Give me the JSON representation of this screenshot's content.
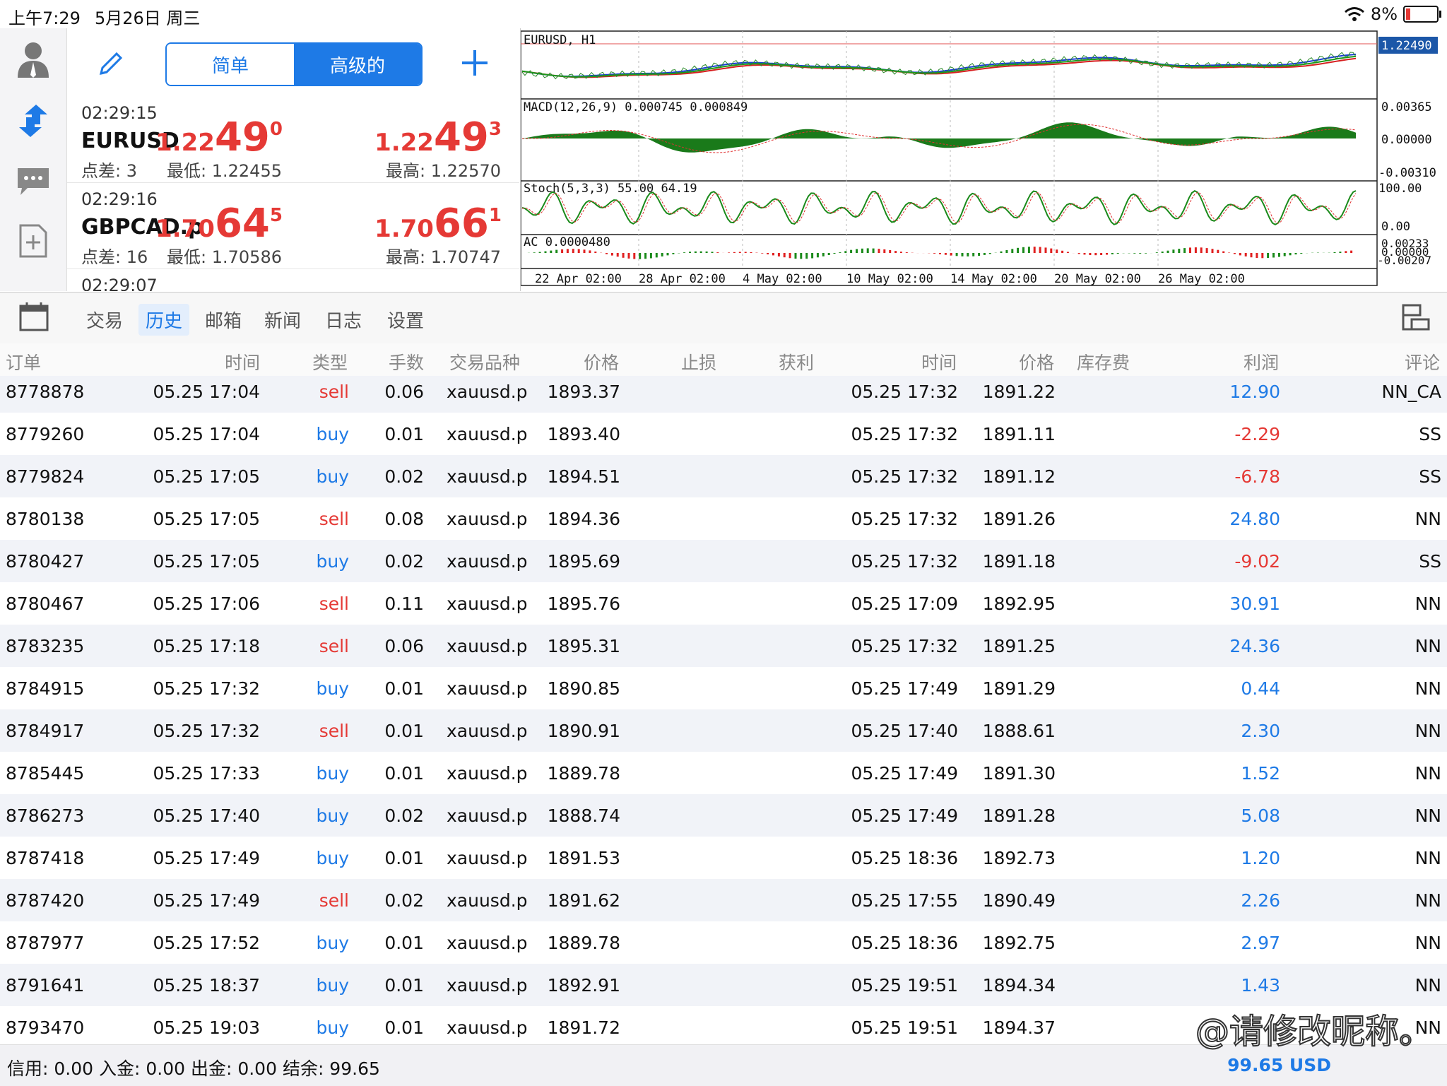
{
  "status_bar": {
    "time": "上午7:29",
    "date": "5月26日 周三",
    "battery": "8%"
  },
  "quotes": {
    "segment": {
      "simple": "简单",
      "advanced": "高级的"
    },
    "items": [
      {
        "time": "02:29:15",
        "symbol": "EURUSD",
        "spread": "点差: 3",
        "bid": {
          "a": "1.22",
          "b": "49",
          "c": "0"
        },
        "ask": {
          "a": "1.22",
          "b": "49",
          "c": "3"
        },
        "low": "最低: 1.22455",
        "high": "最高: 1.22570"
      },
      {
        "time": "02:29:16",
        "symbol": "GBPCAD.p",
        "spread": "点差: 16",
        "bid": {
          "a": "1.70",
          "b": "64",
          "c": "5"
        },
        "ask": {
          "a": "1.70",
          "b": "66",
          "c": "1"
        },
        "low": "最低: 1.70586",
        "high": "最高: 1.70747"
      },
      {
        "time": "02:29:07"
      }
    ]
  },
  "chart": {
    "main_title": "EURUSD, H1",
    "price_label": "1.22490",
    "macd_title": "MACD(12,26,9) 0.000745 0.000849",
    "macd_axis": [
      "0.00365",
      "0.00000",
      "-0.00310"
    ],
    "stoch_title": "Stoch(5,3,3) 55.00 64.19",
    "stoch_axis": [
      "100.00",
      "0.00"
    ],
    "ac_title": "AC 0.0000480",
    "ac_axis": [
      "0.00233",
      "0.00000",
      "-0.00207"
    ],
    "dates": [
      "22 Apr 02:00",
      "28 Apr 02:00",
      "4 May 02:00",
      "10 May 02:00",
      "14 May 02:00",
      "20 May 02:00",
      "26 May 02:00"
    ]
  },
  "tabs": [
    "交易",
    "历史",
    "邮箱",
    "新闻",
    "日志",
    "设置"
  ],
  "active_tab": "历史",
  "table": {
    "headers": [
      "订单",
      "时间",
      "类型",
      "手数",
      "交易品种",
      "价格",
      "止损",
      "获利",
      "时间",
      "价格",
      "库存费",
      "利润",
      "评论"
    ],
    "rows": [
      [
        "8778878",
        "05.25 17:04",
        "sell",
        "0.06",
        "xauusd.p",
        "1893.37",
        "05.25 17:32",
        "1891.22",
        "12.90",
        "NN_CA"
      ],
      [
        "8779260",
        "05.25 17:04",
        "buy",
        "0.01",
        "xauusd.p",
        "1893.40",
        "05.25 17:32",
        "1891.11",
        "-2.29",
        "SS"
      ],
      [
        "8779824",
        "05.25 17:05",
        "buy",
        "0.02",
        "xauusd.p",
        "1894.51",
        "05.25 17:32",
        "1891.12",
        "-6.78",
        "SS"
      ],
      [
        "8780138",
        "05.25 17:05",
        "sell",
        "0.08",
        "xauusd.p",
        "1894.36",
        "05.25 17:32",
        "1891.26",
        "24.80",
        "NN"
      ],
      [
        "8780427",
        "05.25 17:05",
        "buy",
        "0.02",
        "xauusd.p",
        "1895.69",
        "05.25 17:32",
        "1891.18",
        "-9.02",
        "SS"
      ],
      [
        "8780467",
        "05.25 17:06",
        "sell",
        "0.11",
        "xauusd.p",
        "1895.76",
        "05.25 17:09",
        "1892.95",
        "30.91",
        "NN"
      ],
      [
        "8783235",
        "05.25 17:18",
        "sell",
        "0.06",
        "xauusd.p",
        "1895.31",
        "05.25 17:32",
        "1891.25",
        "24.36",
        "NN"
      ],
      [
        "8784915",
        "05.25 17:32",
        "buy",
        "0.01",
        "xauusd.p",
        "1890.85",
        "05.25 17:49",
        "1891.29",
        "0.44",
        "NN"
      ],
      [
        "8784917",
        "05.25 17:32",
        "sell",
        "0.01",
        "xauusd.p",
        "1890.91",
        "05.25 17:40",
        "1888.61",
        "2.30",
        "NN"
      ],
      [
        "8785445",
        "05.25 17:33",
        "buy",
        "0.01",
        "xauusd.p",
        "1889.78",
        "05.25 17:49",
        "1891.30",
        "1.52",
        "NN"
      ],
      [
        "8786273",
        "05.25 17:40",
        "buy",
        "0.02",
        "xauusd.p",
        "1888.74",
        "05.25 17:49",
        "1891.28",
        "5.08",
        "NN"
      ],
      [
        "8787418",
        "05.25 17:49",
        "buy",
        "0.01",
        "xauusd.p",
        "1891.53",
        "05.25 18:36",
        "1892.73",
        "1.20",
        "NN"
      ],
      [
        "8787420",
        "05.25 17:49",
        "sell",
        "0.02",
        "xauusd.p",
        "1891.62",
        "05.25 17:55",
        "1890.49",
        "2.26",
        "NN"
      ],
      [
        "8787977",
        "05.25 17:52",
        "buy",
        "0.01",
        "xauusd.p",
        "1889.78",
        "05.25 18:36",
        "1892.75",
        "2.97",
        "NN"
      ],
      [
        "8791641",
        "05.25 18:37",
        "buy",
        "0.01",
        "xauusd.p",
        "1892.91",
        "05.25 19:51",
        "1894.34",
        "1.43",
        "NN"
      ],
      [
        "8793470",
        "05.25 19:03",
        "buy",
        "0.01",
        "xauusd.p",
        "1891.72",
        "05.25 19:51",
        "1894.37",
        "",
        "NN"
      ]
    ]
  },
  "footer": {
    "summary": "信用:  0.00 入金:  0.00 出金:  0.00 结余:  99.65",
    "balance": "99.65  USD"
  },
  "watermark": "@请修改昵称。",
  "colors": {
    "accent": "#1e7ae6",
    "sell": "#e53935",
    "macd": "#1a7a1a"
  }
}
